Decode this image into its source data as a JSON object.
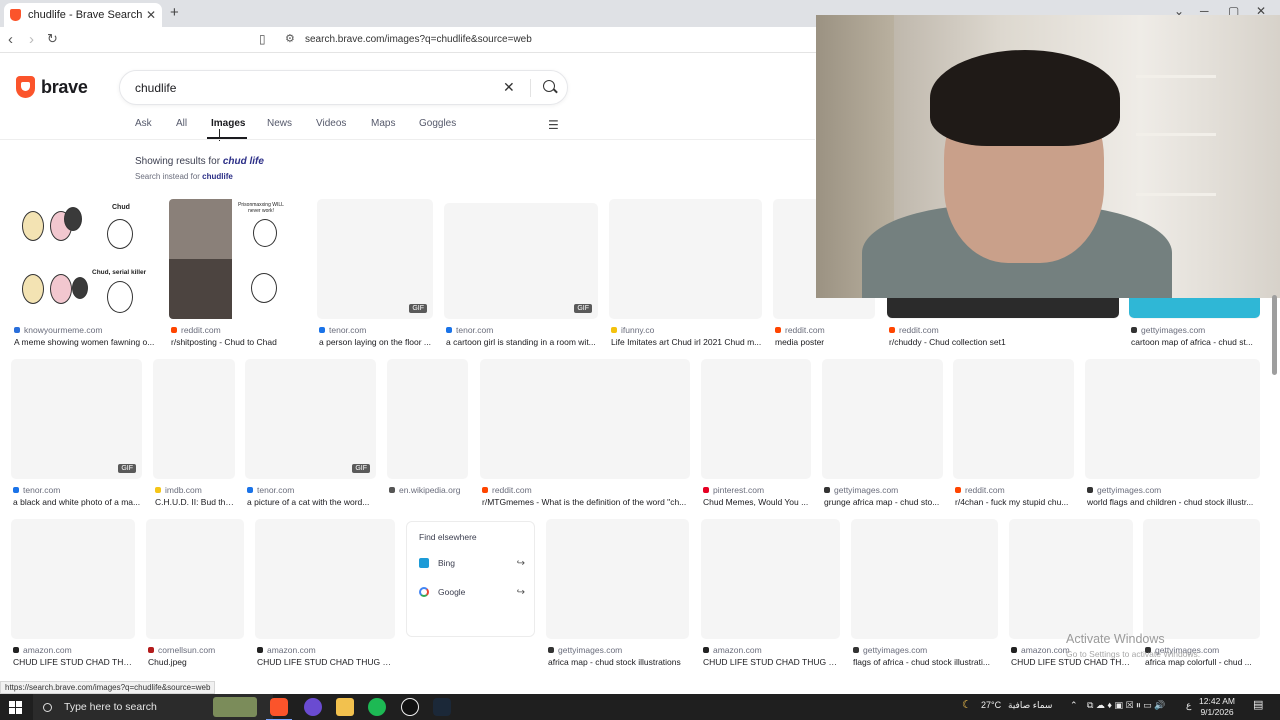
{
  "browser": {
    "tab_title": "chudlife - Brave Search",
    "new_tab": "+",
    "url": "search.brave.com/images?q=chudlife&source=web"
  },
  "search": {
    "brand": "brave",
    "query": "chudlife",
    "tabs": [
      "Ask",
      "All",
      "Images",
      "News",
      "Videos",
      "Maps",
      "Goggles"
    ],
    "active_tab": "Images",
    "showing_prefix": "Showing results for",
    "showing_term": "chud life",
    "instead_prefix": "Search instead for",
    "instead_term": "chudlife"
  },
  "results": [
    {
      "source": "knowyourmeme.com",
      "title": "A meme showing women fawning o...",
      "gif": "",
      "color": "#2a6fdb"
    },
    {
      "source": "reddit.com",
      "title": "r/shitposting - Chud to Chad",
      "gif": "",
      "color": "#ff4500"
    },
    {
      "source": "tenor.com",
      "title": "a person laying on the floor ...",
      "gif": "GIF",
      "color": "#1a73e8"
    },
    {
      "source": "tenor.com",
      "title": "a cartoon girl is standing in a room wit...",
      "gif": "GIF",
      "color": "#1a73e8"
    },
    {
      "source": "ifunny.co",
      "title": "Life Imitates art Chud irl 2021 Chud m...",
      "gif": "",
      "color": "#f4c20d"
    },
    {
      "source": "reddit.com",
      "title": "media poster",
      "gif": "",
      "color": "#ff4500"
    },
    {
      "source": "reddit.com",
      "title": "r/chuddy - Chud collection set1",
      "gif": "",
      "color": "#ff4500"
    },
    {
      "source": "gettyimages.com",
      "title": "cartoon map of africa - chud st...",
      "gif": "",
      "color": "#333333"
    },
    {
      "source": "tenor.com",
      "title": "a black and white photo of a ma...",
      "gif": "GIF",
      "color": "#1a73e8"
    },
    {
      "source": "imdb.com",
      "title": "C.H.U.D. II: Bud the...",
      "gif": "",
      "color": "#f5c518"
    },
    {
      "source": "tenor.com",
      "title": "a picture of a cat with the word...",
      "gif": "GIF",
      "color": "#1a73e8"
    },
    {
      "source": "en.wikipedia.org",
      "title": "",
      "gif": "",
      "color": "#555555"
    },
    {
      "source": "reddit.com",
      "title": "r/MTGmemes - What is the definition of the word \"ch...",
      "gif": "",
      "color": "#ff4500"
    },
    {
      "source": "pinterest.com",
      "title": "Chud Memes, Would You ...",
      "gif": "",
      "color": "#e60023"
    },
    {
      "source": "gettyimages.com",
      "title": "grunge africa map - chud sto...",
      "gif": "",
      "color": "#333333"
    },
    {
      "source": "reddit.com",
      "title": "r/4chan - fuck my stupid chu...",
      "gif": "",
      "color": "#ff4500"
    },
    {
      "source": "gettyimages.com",
      "title": "world flags and children - chud stock illustr...",
      "gif": "",
      "color": "#333333"
    },
    {
      "source": "amazon.com",
      "title": "CHUD LIFE STUD CHAD THU...",
      "gif": "",
      "color": "#222222"
    },
    {
      "source": "cornellsun.com",
      "title": "Chud.jpeg",
      "gif": "",
      "color": "#b31b1b"
    },
    {
      "source": "amazon.com",
      "title": "CHUD LIFE STUD CHAD THUG M...",
      "gif": "",
      "color": "#222222"
    },
    {
      "source": "gettyimages.com",
      "title": "africa map - chud stock illustrations",
      "gif": "",
      "color": "#333333"
    },
    {
      "source": "amazon.com",
      "title": "CHUD LIFE STUD CHAD THUG M...",
      "gif": "",
      "color": "#222222"
    },
    {
      "source": "gettyimages.com",
      "title": "flags of africa - chud stock illustrati...",
      "gif": "",
      "color": "#333333"
    },
    {
      "source": "amazon.com",
      "title": "CHUD LIFE STUD CHAD THU...",
      "gif": "",
      "color": "#222222"
    },
    {
      "source": "gettyimages.com",
      "title": "africa map colorfull - chud ...",
      "gif": "",
      "color": "#333333"
    }
  ],
  "meme_text": {
    "chud": "Chud",
    "serial_killer": "Chud, serial killer",
    "prisonmaxxing": "Prisonmaxxing WILL never work!"
  },
  "find_elsewhere": {
    "heading": "Find elsewhere",
    "options": [
      "Bing",
      "Google"
    ]
  },
  "status_url": "https://search.brave.com/images?q=chudlife&source=web",
  "watermark": {
    "title": "Activate Windows",
    "subtitle": "Go to Settings to activate Windows."
  },
  "taskbar": {
    "search_placeholder": "Type here to search",
    "weather": "27°C",
    "weather_desc": "سماء صافية",
    "lang": "ع",
    "time": "12:42 AM",
    "date": "9/1/2026"
  }
}
